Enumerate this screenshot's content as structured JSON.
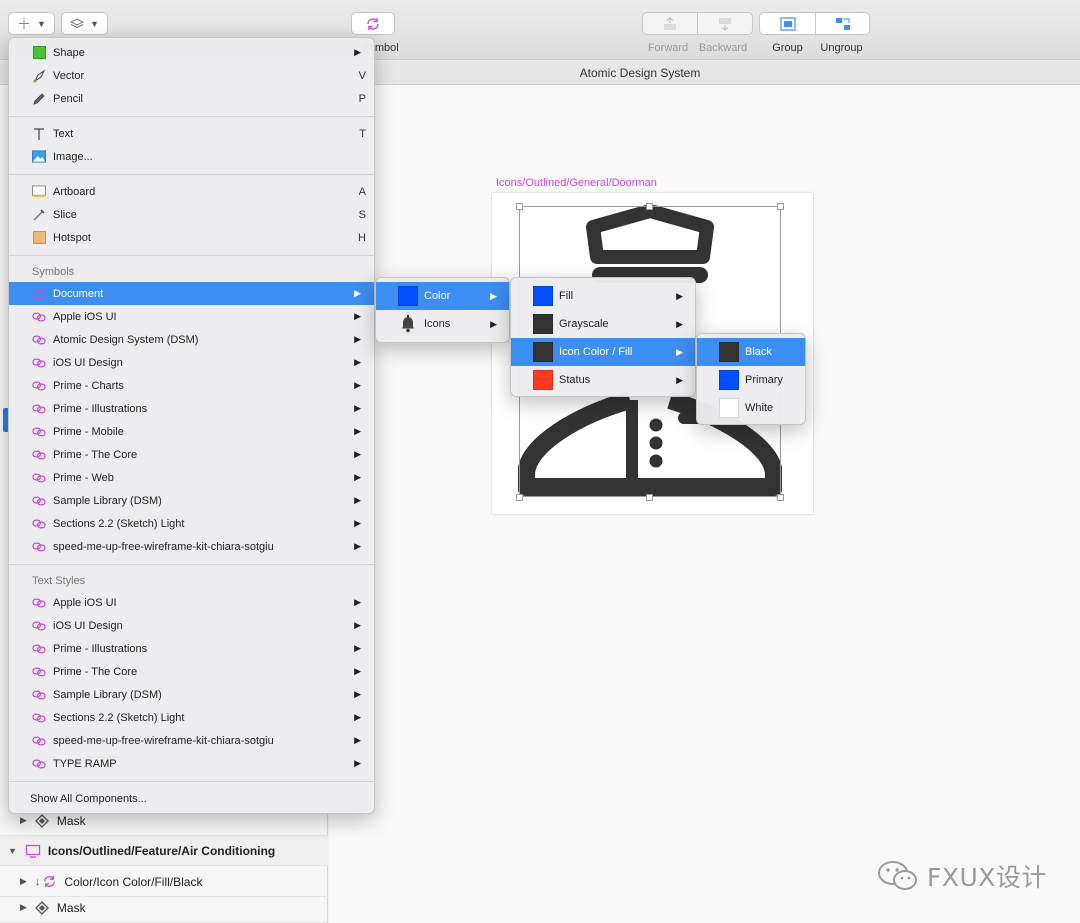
{
  "toolbar": {
    "insert_icon": "plus-icon",
    "layers_icon": "layers-icon",
    "symbol_label": "Symbol",
    "forward_label": "Forward",
    "backward_label": "Backward",
    "group_label": "Group",
    "ungroup_label": "Ungroup"
  },
  "document": {
    "title": "Atomic Design System"
  },
  "artboard": {
    "label": "Icons/Outlined/General/Doorman"
  },
  "insert_menu": {
    "tools": [
      {
        "label": "Shape",
        "shortcut": "",
        "icon": "shape-icon",
        "submenu": true
      },
      {
        "label": "Vector",
        "shortcut": "V",
        "icon": "vector-pen-icon",
        "submenu": false
      },
      {
        "label": "Pencil",
        "shortcut": "P",
        "icon": "pencil-icon",
        "submenu": false
      }
    ],
    "content": [
      {
        "label": "Text",
        "shortcut": "T",
        "icon": "text-icon"
      },
      {
        "label": "Image...",
        "shortcut": "",
        "icon": "image-icon"
      }
    ],
    "frames": [
      {
        "label": "Artboard",
        "shortcut": "A",
        "icon": "artboard-icon"
      },
      {
        "label": "Slice",
        "shortcut": "S",
        "icon": "slice-icon"
      },
      {
        "label": "Hotspot",
        "shortcut": "H",
        "icon": "hotspot-icon"
      }
    ],
    "symbols_header": "Symbols",
    "symbols": [
      "Document",
      "Apple iOS UI",
      "Atomic Design System (DSM)",
      "iOS UI Design",
      "Prime - Charts",
      "Prime - Illustrations",
      "Prime - Mobile",
      "Prime - The Core",
      "Prime - Web",
      "Sample Library (DSM)",
      "Sections 2.2 (Sketch) Light",
      "speed-me-up-free-wireframe-kit-chiara-sotgiu"
    ],
    "text_styles_header": "Text Styles",
    "text_styles": [
      "Apple iOS UI",
      "iOS UI Design",
      "Prime - Illustrations",
      "Prime - The Core",
      "Sample Library (DSM)",
      "Sections 2.2 (Sketch) Light",
      "speed-me-up-free-wireframe-kit-chiara-sotgiu",
      "TYPE RAMP"
    ],
    "show_all": "Show All Components..."
  },
  "document_submenu": [
    {
      "label": "Color",
      "color": "#0050ff"
    },
    {
      "label": "Icons",
      "icon": "bell-icon"
    }
  ],
  "color_submenu": [
    {
      "label": "Fill",
      "color": "#0050ff"
    },
    {
      "label": "Grayscale",
      "color": "#333333"
    },
    {
      "label": "Icon Color / Fill",
      "color": "#333333"
    },
    {
      "label": "Status",
      "color": "#ff3b1f"
    }
  ],
  "fill_submenu": [
    {
      "label": "Black",
      "color": "#333333"
    },
    {
      "label": "Primary",
      "color": "#0050ff"
    },
    {
      "label": "White",
      "color": "#ffffff"
    }
  ],
  "layers": [
    {
      "label": "Mask",
      "icon": "mask-icon"
    },
    {
      "label": "Icons/Outlined/Feature/Air Conditioning",
      "icon": "artboard-icon"
    },
    {
      "label": "Color/Icon Color/Fill/Black",
      "icon": "symbol-icon"
    },
    {
      "label": "Mask",
      "icon": "mask-icon"
    }
  ],
  "watermark": {
    "text": "FXUX设计"
  },
  "colors": {
    "highlight": "#3d8ef2",
    "symbol": "#c74ad6"
  }
}
